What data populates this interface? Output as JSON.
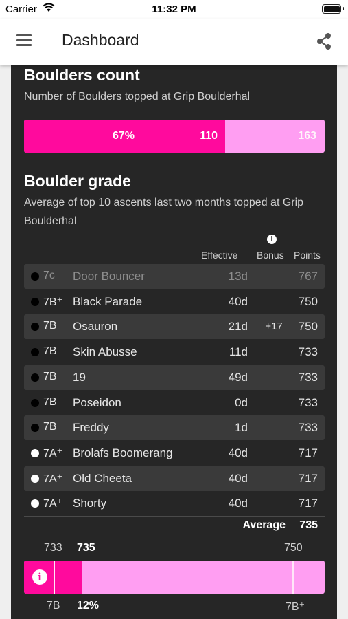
{
  "status_bar": {
    "carrier": "Carrier",
    "time": "11:32 PM"
  },
  "app_bar": {
    "title": "Dashboard"
  },
  "boulders_count": {
    "title": "Boulders count",
    "subtitle": "Number of Boulders topped at Grip Boulderhal",
    "percent_label": "67%",
    "topped": "110",
    "total": "163",
    "fill_fraction": 0.67,
    "colors": {
      "fill": "#ff0a9d",
      "track": "#ff9ef2"
    }
  },
  "boulder_grade": {
    "title": "Boulder grade",
    "subtitle": "Average of top 10 ascents last two months topped at Grip Boulderhal",
    "columns": {
      "effective": "Effective",
      "bonus": "Bonus",
      "points": "Points"
    },
    "rows": [
      {
        "dot": "black",
        "grade": "7c",
        "name": "Door Bouncer",
        "effective": "13d",
        "bonus": "",
        "points": "767",
        "faded": true
      },
      {
        "dot": "black",
        "grade": "7B⁺",
        "name": "Black Parade",
        "effective": "40d",
        "bonus": "",
        "points": "750"
      },
      {
        "dot": "black",
        "grade": "7B",
        "name": "Osauron",
        "effective": "21d",
        "bonus": "+17",
        "points": "750"
      },
      {
        "dot": "black",
        "grade": "7B",
        "name": "Skin Abusse",
        "effective": "11d",
        "bonus": "",
        "points": "733"
      },
      {
        "dot": "black",
        "grade": "7B",
        "name": "19",
        "effective": "49d",
        "bonus": "",
        "points": "733"
      },
      {
        "dot": "black",
        "grade": "7B",
        "name": "Poseidon",
        "effective": "0d",
        "bonus": "",
        "points": "733"
      },
      {
        "dot": "black",
        "grade": "7B",
        "name": "Freddy",
        "effective": "1d",
        "bonus": "",
        "points": "733"
      },
      {
        "dot": "white",
        "grade": "7A⁺",
        "name": "Brolafs Boomerang",
        "effective": "40d",
        "bonus": "",
        "points": "717"
      },
      {
        "dot": "white",
        "grade": "7A⁺",
        "name": "Old Cheeta",
        "effective": "40d",
        "bonus": "",
        "points": "717"
      },
      {
        "dot": "white",
        "grade": "7A⁺",
        "name": "Shorty",
        "effective": "40d",
        "bonus": "",
        "points": "717"
      }
    ],
    "average_label": "Average",
    "average_value": "735",
    "scale": {
      "low_points": "733",
      "current_points": "735",
      "high_points": "750",
      "low_grade": "7B",
      "progress_label": "12%",
      "high_grade": "7B⁺",
      "progress_fraction": 0.12
    }
  }
}
